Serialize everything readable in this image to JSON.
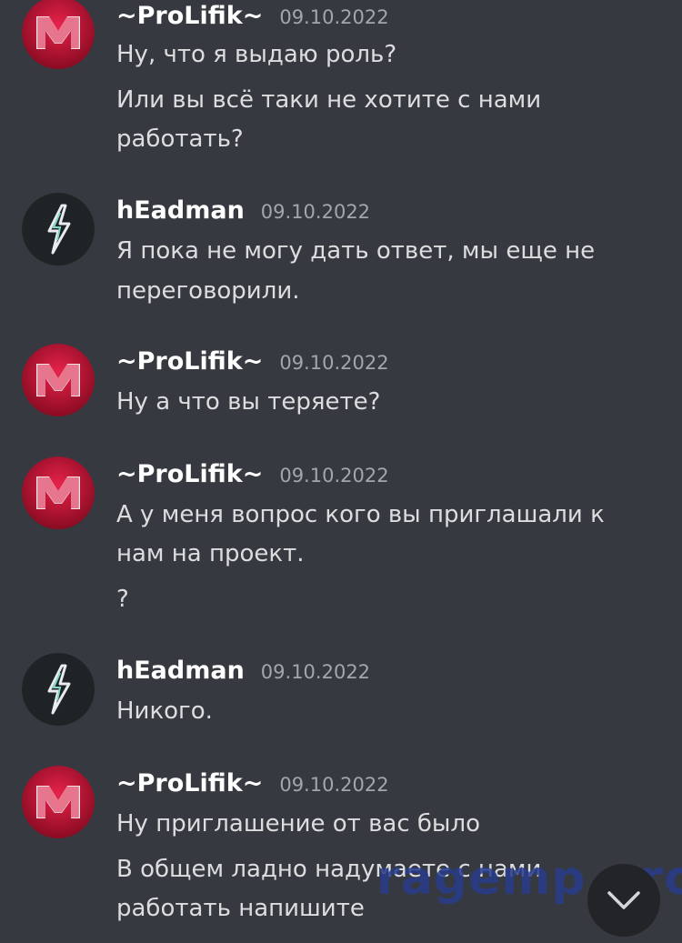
{
  "colors": {
    "background": "#36393f",
    "author": "#ffffff",
    "timestamp": "#a3a6aa",
    "message_text": "#dcddde",
    "prolifik_avatar": "#c8143c",
    "headman_avatar": "#1f2326"
  },
  "messages": [
    {
      "author": "~ProLifik~",
      "timestamp": "09.10.2022",
      "avatar_icon": "red-m-logo-icon",
      "lines": [
        "Ну, что я выдаю роль?",
        "Или вы всё таки не хотите с нами",
        "работать?"
      ]
    },
    {
      "author": "hEadman",
      "timestamp": "09.10.2022",
      "avatar_icon": "lightning-logo-icon",
      "lines": [
        "Я пока не могу дать ответ, мы еще не",
        "переговорили."
      ]
    },
    {
      "author": "~ProLifik~",
      "timestamp": "09.10.2022",
      "avatar_icon": "red-m-logo-icon",
      "lines": [
        "Ну а что вы теряете?"
      ]
    },
    {
      "author": "~ProLifik~",
      "timestamp": "09.10.2022",
      "avatar_icon": "red-m-logo-icon",
      "lines": [
        "А у меня вопрос кого вы приглашали к",
        "нам на проект.",
        "?"
      ]
    },
    {
      "author": "hEadman",
      "timestamp": "09.10.2022",
      "avatar_icon": "lightning-logo-icon",
      "lines": [
        "Никого."
      ]
    },
    {
      "author": "~ProLifik~",
      "timestamp": "09.10.2022",
      "avatar_icon": "red-m-logo-icon",
      "lines": [
        "Ну приглашение от вас было",
        "В общем ладно надумаете с нами",
        "работать напишите"
      ]
    }
  ],
  "watermark": "ragemp.pro",
  "scroll_button_icon": "chevron-down-icon"
}
